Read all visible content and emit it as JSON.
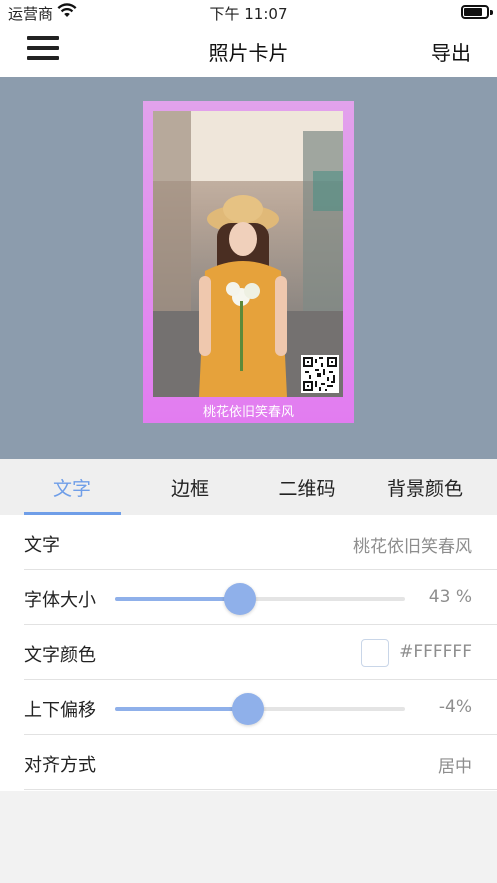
{
  "status_bar": {
    "carrier": "运营商",
    "time": "下午 11:07"
  },
  "nav": {
    "title": "照片卡片",
    "export_label": "导出"
  },
  "card": {
    "caption": "桃花依旧笑春风"
  },
  "tabs": [
    {
      "label": "文字",
      "active": true
    },
    {
      "label": "边框",
      "active": false
    },
    {
      "label": "二维码",
      "active": false
    },
    {
      "label": "背景颜色",
      "active": false
    }
  ],
  "settings": {
    "text": {
      "label": "文字",
      "value": "桃花依旧笑春风"
    },
    "font_size": {
      "label": "字体大小",
      "value": "43 %",
      "level": 0.43
    },
    "text_color": {
      "label": "文字颜色",
      "value": "#FFFFFF",
      "color": "#FFFFFF"
    },
    "vertical_offset": {
      "label": "上下偏移",
      "value": "-4%",
      "level": 0.46
    },
    "alignment": {
      "label": "对齐方式",
      "value": "居中"
    }
  },
  "colors": {
    "accent": "#6f9ee8",
    "slider": "#8fb0ea",
    "preview_bg": "#8c9cad"
  }
}
